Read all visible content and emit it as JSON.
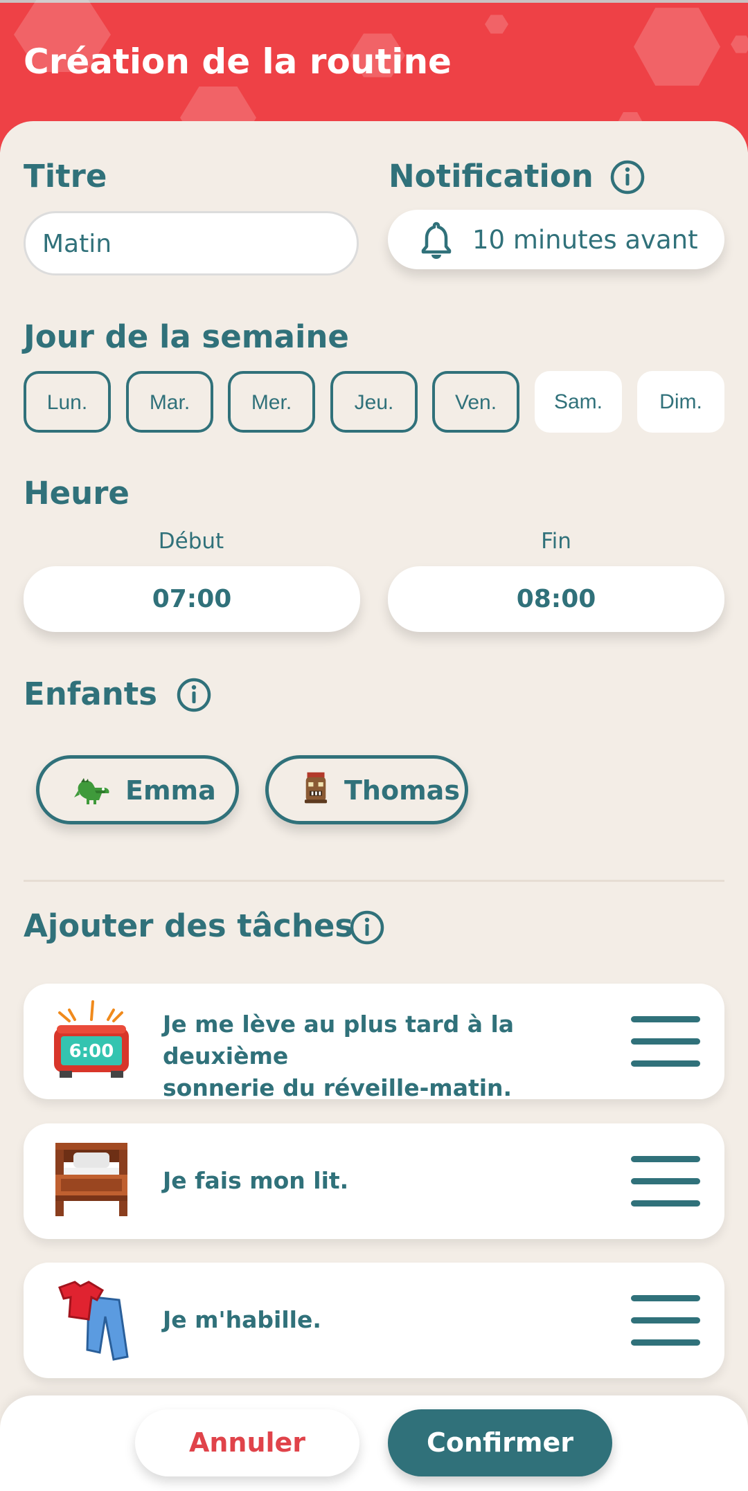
{
  "header": {
    "title": "Création de la routine"
  },
  "title_section": {
    "label": "Titre",
    "value": "Matin"
  },
  "notification": {
    "label": "Notification",
    "value": "10 minutes avant",
    "icon": "bell-icon"
  },
  "days": {
    "label": "Jour de la semaine",
    "items": [
      {
        "label": "Lun.",
        "selected": true
      },
      {
        "label": "Mar.",
        "selected": true
      },
      {
        "label": "Mer.",
        "selected": true
      },
      {
        "label": "Jeu.",
        "selected": true
      },
      {
        "label": "Ven.",
        "selected": true
      },
      {
        "label": "Sam.",
        "selected": false
      },
      {
        "label": "Dim.",
        "selected": false
      }
    ]
  },
  "time": {
    "label": "Heure",
    "start_label": "Début",
    "start": "07:00",
    "end_label": "Fin",
    "end": "08:00"
  },
  "children": {
    "label": "Enfants",
    "items": [
      {
        "name": "Emma",
        "avatar": "dinosaur-avatar"
      },
      {
        "name": "Thomas",
        "avatar": "tiki-mask-avatar"
      }
    ]
  },
  "tasks": {
    "label": "Ajouter des tâches",
    "items": [
      {
        "line1": "Je me lève au plus tard à la deuxième",
        "line2": "sonnerie du réveille-matin.",
        "icon": "alarm-clock-icon",
        "clock_text": "6:00"
      },
      {
        "line1": "Je fais mon lit.",
        "line2": "",
        "icon": "bed-icon"
      },
      {
        "line1": "Je m'habille.",
        "line2": "",
        "icon": "clothes-icon"
      }
    ]
  },
  "actions": {
    "cancel": "Annuler",
    "confirm": "Confirmer"
  },
  "colors": {
    "brand_red": "#ee4146",
    "teal": "#30717a",
    "background": "#f3ede6",
    "cancel_text": "#e0434a"
  }
}
